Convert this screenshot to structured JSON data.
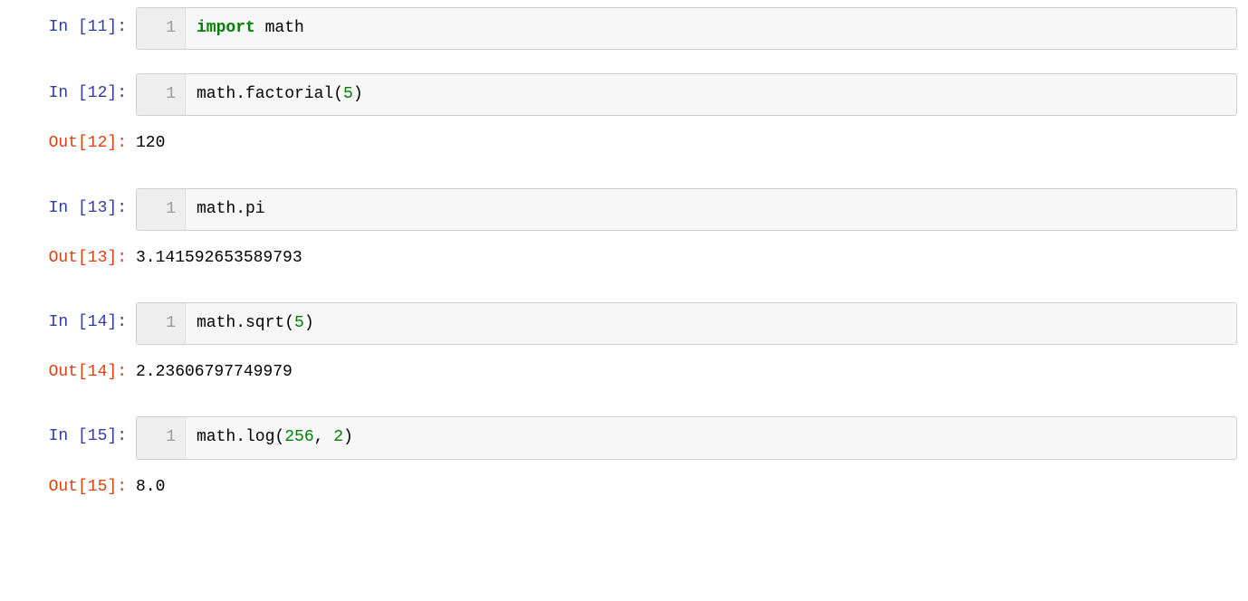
{
  "cells": [
    {
      "in_prompt": "In [11]:",
      "line_no": "1",
      "tokens": [
        {
          "t": "import",
          "c": "kw"
        },
        {
          "t": " ",
          "c": ""
        },
        {
          "t": "math",
          "c": ""
        }
      ]
    },
    {
      "in_prompt": "In [12]:",
      "line_no": "1",
      "tokens": [
        {
          "t": "math.factorial(",
          "c": ""
        },
        {
          "t": "5",
          "c": "num"
        },
        {
          "t": ")",
          "c": ""
        }
      ],
      "out_prompt": "Out[12]:",
      "output": "120"
    },
    {
      "in_prompt": "In [13]:",
      "line_no": "1",
      "tokens": [
        {
          "t": "math.pi",
          "c": ""
        }
      ],
      "out_prompt": "Out[13]:",
      "output": "3.141592653589793"
    },
    {
      "in_prompt": "In [14]:",
      "line_no": "1",
      "tokens": [
        {
          "t": "math.sqrt(",
          "c": ""
        },
        {
          "t": "5",
          "c": "num"
        },
        {
          "t": ")",
          "c": ""
        }
      ],
      "out_prompt": "Out[14]:",
      "output": "2.23606797749979"
    },
    {
      "in_prompt": "In [15]:",
      "line_no": "1",
      "tokens": [
        {
          "t": "math.log(",
          "c": ""
        },
        {
          "t": "256",
          "c": "num"
        },
        {
          "t": ", ",
          "c": ""
        },
        {
          "t": "2",
          "c": "num"
        },
        {
          "t": ")",
          "c": ""
        }
      ],
      "out_prompt": "Out[15]:",
      "output": "8.0"
    }
  ]
}
